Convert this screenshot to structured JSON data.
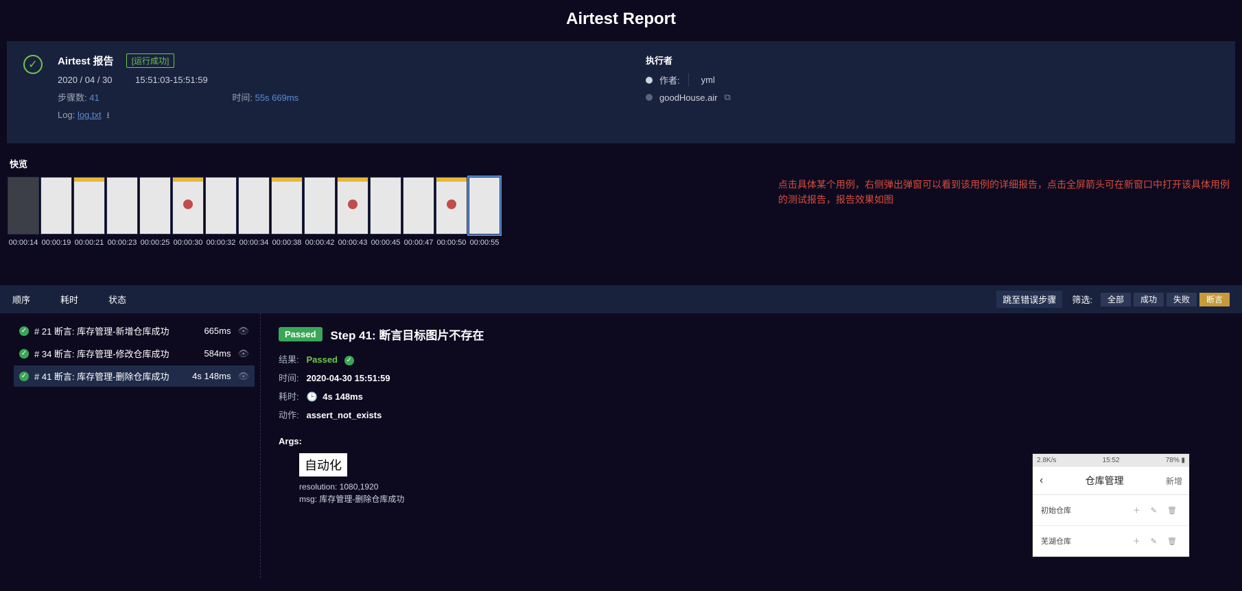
{
  "page_title": "Airtest Report",
  "header": {
    "title": "Airtest 报告",
    "run_status": "[运行成功]",
    "date": "2020 / 04 / 30",
    "time_range": "15:51:03-15:51:59",
    "steps_label": "步骤数:",
    "steps_count": "41",
    "duration_label": "时间:",
    "duration": "55s 669ms",
    "log_label": "Log:",
    "log_file": "log.txt"
  },
  "executor": {
    "section": "执行者",
    "author_label": "作者:",
    "author": "yml",
    "script": "goodHouse.air"
  },
  "quickview": {
    "label": "快览",
    "annotation": "点击具体某个用例，右侧弹出弹窗可以看到该用例的详细报告，点击全屏箭头可在新窗口中打开该具体用例的测试报告，报告效果如图",
    "thumbs": [
      {
        "time": "00:00:14",
        "style": "dark"
      },
      {
        "time": "00:00:19",
        "style": "light"
      },
      {
        "time": "00:00:21",
        "style": "yellow"
      },
      {
        "time": "00:00:23",
        "style": "light"
      },
      {
        "time": "00:00:25",
        "style": "light"
      },
      {
        "time": "00:00:30",
        "style": "yellowdot"
      },
      {
        "time": "00:00:32",
        "style": "light"
      },
      {
        "time": "00:00:34",
        "style": "light"
      },
      {
        "time": "00:00:38",
        "style": "yellow"
      },
      {
        "time": "00:00:42",
        "style": "light"
      },
      {
        "time": "00:00:43",
        "style": "yellowdot"
      },
      {
        "time": "00:00:45",
        "style": "light"
      },
      {
        "time": "00:00:47",
        "style": "light"
      },
      {
        "time": "00:00:50",
        "style": "yellowdot"
      },
      {
        "time": "00:00:55",
        "style": "light",
        "selected": true
      }
    ]
  },
  "step_tabs": {
    "order": "顺序",
    "elapsed": "耗时",
    "status": "状态",
    "jump_error": "跳至错误步骤",
    "filter_label": "筛选:",
    "filters": [
      {
        "label": "全部",
        "active": false
      },
      {
        "label": "成功",
        "active": false
      },
      {
        "label": "失败",
        "active": false
      },
      {
        "label": "断言",
        "active": true
      }
    ]
  },
  "step_list": [
    {
      "idx": "# 21",
      "kind": "断言:",
      "name": "库存管理-新增仓库成功",
      "time": "665ms",
      "selected": false
    },
    {
      "idx": "# 34",
      "kind": "断言:",
      "name": "库存管理-修改仓库成功",
      "time": "584ms",
      "selected": false
    },
    {
      "idx": "# 41",
      "kind": "断言:",
      "name": "库存管理-删除仓库成功",
      "time": "4s 148ms",
      "selected": true
    }
  ],
  "detail": {
    "badge": "Passed",
    "title": "Step 41: 断言目标图片不存在",
    "result_label": "结果:",
    "result_value": "Passed",
    "time_label": "时间:",
    "time_value": "2020-04-30 15:51:59",
    "elapsed_label": "耗时:",
    "elapsed_value": "4s 148ms",
    "action_label": "动作:",
    "action_value": "assert_not_exists",
    "args_title": "Args:",
    "args_tag": "自动化",
    "args_resolution": "resolution: 1080,1920",
    "args_msg": "msg: 库存管理-删除仓库成功"
  },
  "device": {
    "status_left": "2.8K/s",
    "status_mid": "15:52",
    "status_right": "78%",
    "nav_title": "仓库管理",
    "nav_add": "新增",
    "rows": [
      {
        "name": "初始仓库"
      },
      {
        "name": "芜湖仓库"
      }
    ]
  }
}
